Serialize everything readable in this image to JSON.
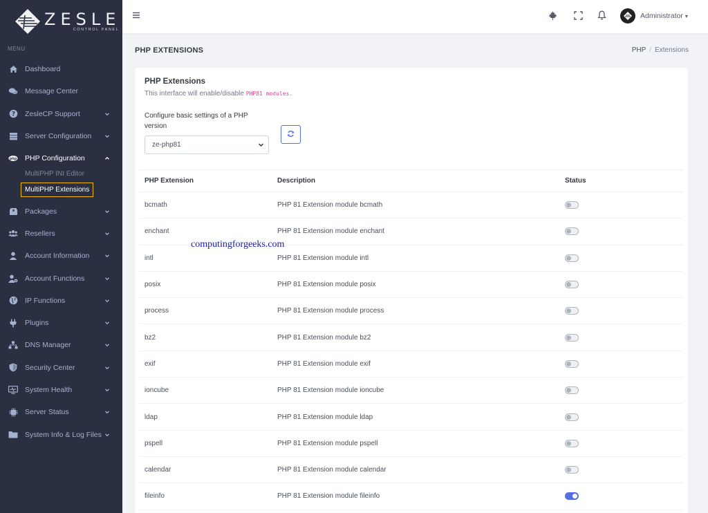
{
  "brand": {
    "name": "ZESLE",
    "tagline": "CONTROL PANEL"
  },
  "sidebar": {
    "menu_title": "MENU",
    "items": [
      {
        "label": "Dashboard",
        "icon": "home-icon",
        "chevron": false
      },
      {
        "label": "Message Center",
        "icon": "chat-icon",
        "chevron": false
      },
      {
        "label": "ZesleCP Support",
        "icon": "help-circle-icon",
        "chevron": true
      },
      {
        "label": "Server Configuration",
        "icon": "server-icon",
        "chevron": true
      },
      {
        "label": "PHP Configuration",
        "icon": "php-icon",
        "chevron": true,
        "expanded": true
      },
      {
        "label": "Packages",
        "icon": "package-icon",
        "chevron": true
      },
      {
        "label": "Resellers",
        "icon": "users-icon",
        "chevron": true
      },
      {
        "label": "Account Information",
        "icon": "user-icon",
        "chevron": true
      },
      {
        "label": "Account Functions",
        "icon": "user-gear-icon",
        "chevron": true
      },
      {
        "label": "IP Functions",
        "icon": "globe-icon",
        "chevron": true
      },
      {
        "label": "Plugins",
        "icon": "plug-icon",
        "chevron": true
      },
      {
        "label": "DNS Manager",
        "icon": "network-icon",
        "chevron": true
      },
      {
        "label": "Security Center",
        "icon": "shield-icon",
        "chevron": true
      },
      {
        "label": "System Health",
        "icon": "monitor-icon",
        "chevron": true
      },
      {
        "label": "Server Status",
        "icon": "chip-icon",
        "chevron": true
      },
      {
        "label": "System Info & Log Files",
        "icon": "folder-icon",
        "chevron": true
      }
    ],
    "php_sub": [
      {
        "label": "MultiPHP INI Editor"
      },
      {
        "label": "MultiPHP Extensions"
      }
    ]
  },
  "topbar": {
    "user_name": "Administrator"
  },
  "page": {
    "title": "PHP EXTENSIONS",
    "breadcrumb": [
      "PHP",
      "Extensions"
    ]
  },
  "card": {
    "title": "PHP Extensions",
    "desc_prefix": "This interface will enable/disable",
    "desc_code": "PHP81 modules.",
    "config_label": "Configure basic settings of a PHP version",
    "selected_version": "ze-php81"
  },
  "table": {
    "headers": [
      "PHP Extension",
      "Description",
      "Status"
    ],
    "rows": [
      {
        "name": "bcmath",
        "desc": "PHP 81 Extension module bcmath",
        "enabled": false
      },
      {
        "name": "enchant",
        "desc": "PHP 81 Extension module enchant",
        "enabled": false
      },
      {
        "name": "intl",
        "desc": "PHP 81 Extension module intl",
        "enabled": false
      },
      {
        "name": "posix",
        "desc": "PHP 81 Extension module posix",
        "enabled": false
      },
      {
        "name": "process",
        "desc": "PHP 81 Extension module process",
        "enabled": false
      },
      {
        "name": "bz2",
        "desc": "PHP 81 Extension module bz2",
        "enabled": false
      },
      {
        "name": "exif",
        "desc": "PHP 81 Extension module exif",
        "enabled": false
      },
      {
        "name": "ioncube",
        "desc": "PHP 81 Extension module ioncube",
        "enabled": false
      },
      {
        "name": "ldap",
        "desc": "PHP 81 Extension module ldap",
        "enabled": false
      },
      {
        "name": "pspell",
        "desc": "PHP 81 Extension module pspell",
        "enabled": false
      },
      {
        "name": "calendar",
        "desc": "PHP 81 Extension module calendar",
        "enabled": false
      },
      {
        "name": "fileinfo",
        "desc": "PHP 81 Extension module fileinfo",
        "enabled": true
      }
    ]
  },
  "watermark": "computingforgeeks.com",
  "colors": {
    "sidebar_bg": "#2a3042",
    "accent": "#556ee6",
    "highlight_border": "#f2b705"
  }
}
